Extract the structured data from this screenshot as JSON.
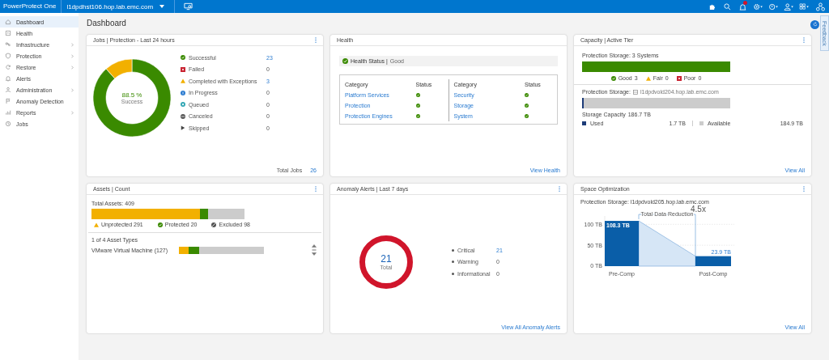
{
  "top_bar": {
    "product": "PowerProtect One",
    "host": "l1dpdhst106.hop.lab.emc.com",
    "notification_badge": true
  },
  "sidebar": {
    "items": [
      {
        "label": "Dashboard",
        "selected": true,
        "expandable": false
      },
      {
        "label": "Health",
        "selected": false,
        "expandable": false
      },
      {
        "label": "Infrastructure",
        "selected": false,
        "expandable": true
      },
      {
        "label": "Protection",
        "selected": false,
        "expandable": true
      },
      {
        "label": "Restore",
        "selected": false,
        "expandable": true
      },
      {
        "label": "Alerts",
        "selected": false,
        "expandable": false
      },
      {
        "label": "Administration",
        "selected": false,
        "expandable": true
      },
      {
        "label": "Anomaly Detection",
        "selected": false,
        "expandable": false
      },
      {
        "label": "Reports",
        "selected": false,
        "expandable": true
      },
      {
        "label": "Jobs",
        "selected": false,
        "expandable": false
      }
    ]
  },
  "page_title": "Dashboard",
  "jobs": {
    "title": "Jobs | Protection - Last 24 hours",
    "menu": true,
    "center_value": "88.5 %",
    "center_label": "Success",
    "legend": [
      {
        "label": "Successful",
        "count": "23",
        "kind": "check",
        "link": true
      },
      {
        "label": "Failed",
        "count": "0",
        "kind": "cross",
        "link": false
      },
      {
        "label": "Completed with Exceptions",
        "count": "3",
        "kind": "triangle",
        "link": true
      },
      {
        "label": "In Progress",
        "count": "0",
        "kind": "progress",
        "link": false
      },
      {
        "label": "Queued",
        "count": "0",
        "kind": "queued",
        "link": false
      },
      {
        "label": "Canceled",
        "count": "0",
        "kind": "canceled",
        "link": false
      },
      {
        "label": "Skipped",
        "count": "0",
        "kind": "skipped",
        "link": false
      }
    ],
    "total_label": "Total Jobs",
    "total": "26"
  },
  "health": {
    "title": "Health",
    "status_label": "Health Status |",
    "status": "Good",
    "ok": true,
    "tables": [
      {
        "columns": [
          "Category",
          "Status"
        ],
        "rows": [
          {
            "category": "Platform Services",
            "ok": true
          },
          {
            "category": "Protection",
            "ok": true
          },
          {
            "category": "Protection Engines",
            "ok": true
          }
        ]
      },
      {
        "columns": [
          "Category",
          "Status"
        ],
        "rows": [
          {
            "category": "Security",
            "ok": true
          },
          {
            "category": "Storage",
            "ok": true
          },
          {
            "category": "System",
            "ok": true
          }
        ]
      }
    ],
    "link": "View Health"
  },
  "capacity": {
    "title": "Capacity | Active Tier",
    "menu": true,
    "systems_label": "Protection Storage: 3 Systems",
    "segments": [
      {
        "label": "Good",
        "count": "3",
        "kind": "check",
        "color": "#3a8a00"
      },
      {
        "label": "Fair",
        "count": "0",
        "kind": "triangle",
        "color": "#f2b000"
      },
      {
        "label": "Poor",
        "count": "0",
        "kind": "cross",
        "color": "#c8202f"
      }
    ],
    "storage_label": "Protection Storage:",
    "storage_host": "l1dpdvold204.hop.lab.emc.com",
    "capacity_label": "Storage Capacity",
    "capacity": "186.7 TB",
    "usage": [
      {
        "label": "Used",
        "value": "1.7 TB",
        "color": "#1d3c78",
        "level": 0.009
      },
      {
        "label": "Available",
        "value": "184.9 TB",
        "color": "#cccccc"
      }
    ],
    "link": "View All"
  },
  "assets": {
    "title": "Assets | Count",
    "menu": true,
    "total": "Total Assets: 409",
    "segments": [
      {
        "label": "Unprotected 291",
        "kind": "triangle",
        "color": "#f2b000"
      },
      {
        "label": "Protected 20",
        "kind": "check",
        "color": "#3a8a00"
      },
      {
        "label": "Excluded 98",
        "kind": "canceled",
        "color": "#cccccc"
      }
    ],
    "types_label": "1 of 4 Asset Types",
    "types": [
      {
        "name": "VMware Virtual Machine (127)",
        "segments": [
          {
            "color": "#f2b000",
            "level": 0.11
          },
          {
            "color": "#3a8a00",
            "level": 0.13
          },
          {
            "color": "#cccccc"
          }
        ]
      }
    ]
  },
  "anomaly": {
    "title": "Anomaly Alerts | Last 7 days",
    "menu": true,
    "total": "21",
    "total_label": "Total",
    "legend": [
      {
        "label": "Critical",
        "count": "21",
        "link": true
      },
      {
        "label": "Warning",
        "count": "0",
        "link": false
      },
      {
        "label": "Informational",
        "count": "0",
        "link": false
      }
    ],
    "link": "View All Anomaly Alerts"
  },
  "space": {
    "title": "Space Optimization",
    "menu": true,
    "storage": "Protection Storage: l1dpdvold205.hop.lab.emc.com",
    "ratio": "4.5x",
    "chart_data": {
      "type": "bar",
      "categories": [
        "Pre-Comp",
        "Post-Comp"
      ],
      "values": [
        108.3,
        23.9
      ],
      "ylim": [
        0,
        120
      ],
      "yticks": [
        {
          "value": 0,
          "label": "0 TB"
        },
        {
          "value": 50,
          "label": "50 TB"
        },
        {
          "value": 100,
          "label": "100 TB"
        }
      ],
      "value_labels": [
        "108.3 TB",
        "23.9 TB"
      ],
      "annotations": [
        {
          "text": "Total Data Reduction"
        }
      ]
    },
    "link": "View All"
  },
  "feedback": "Feedback"
}
